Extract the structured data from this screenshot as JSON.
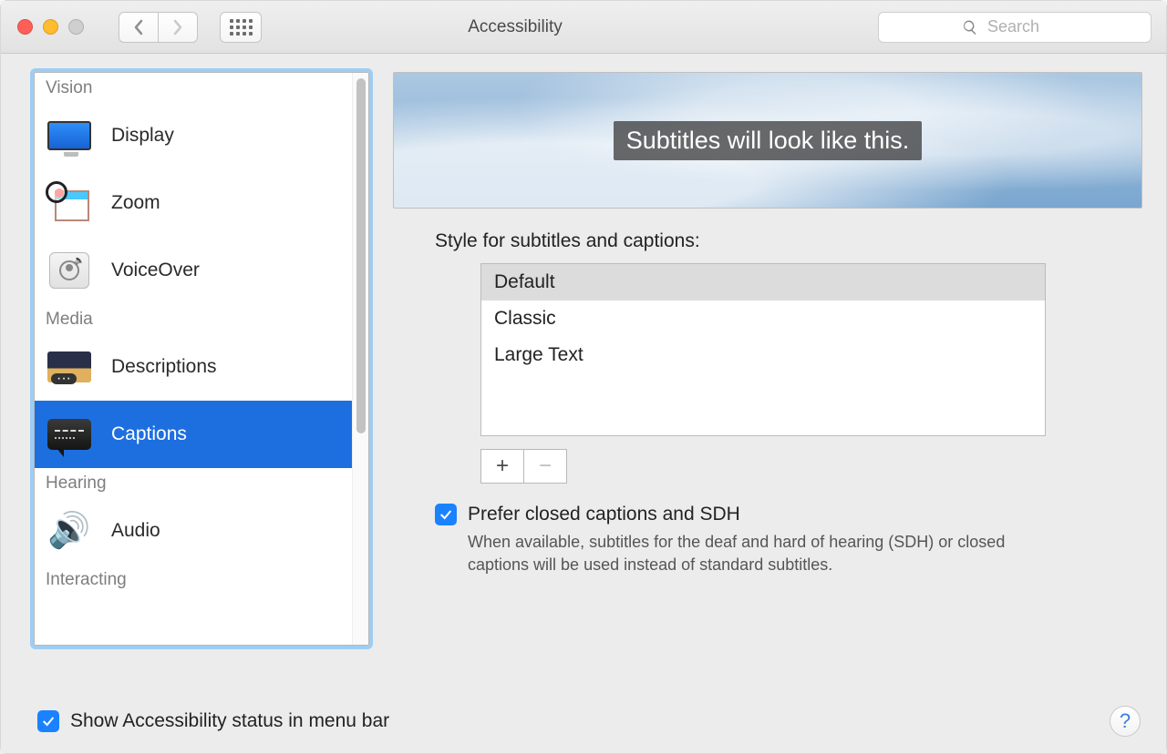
{
  "window": {
    "title": "Accessibility"
  },
  "search": {
    "placeholder": "Search"
  },
  "sidebar": {
    "groups": [
      {
        "label": "Vision",
        "items": [
          {
            "label": "Display"
          },
          {
            "label": "Zoom"
          },
          {
            "label": "VoiceOver"
          }
        ]
      },
      {
        "label": "Media",
        "items": [
          {
            "label": "Descriptions"
          },
          {
            "label": "Captions"
          }
        ]
      },
      {
        "label": "Hearing",
        "items": [
          {
            "label": "Audio"
          }
        ]
      },
      {
        "label": "Interacting",
        "items": []
      }
    ],
    "selected": "Captions"
  },
  "preview": {
    "sample_text": "Subtitles will look like this."
  },
  "styles": {
    "label": "Style for subtitles and captions:",
    "options": [
      "Default",
      "Classic",
      "Large Text"
    ],
    "selected": "Default"
  },
  "buttons": {
    "add": "+",
    "remove": "−"
  },
  "prefer_sdh": {
    "checked": true,
    "label": "Prefer closed captions and SDH",
    "description": "When available, subtitles for the deaf and hard of hearing (SDH) or closed captions will be used instead of standard subtitles."
  },
  "footer": {
    "show_status_checked": true,
    "show_status_label": "Show Accessibility status in menu bar"
  },
  "help": {
    "label": "?"
  }
}
